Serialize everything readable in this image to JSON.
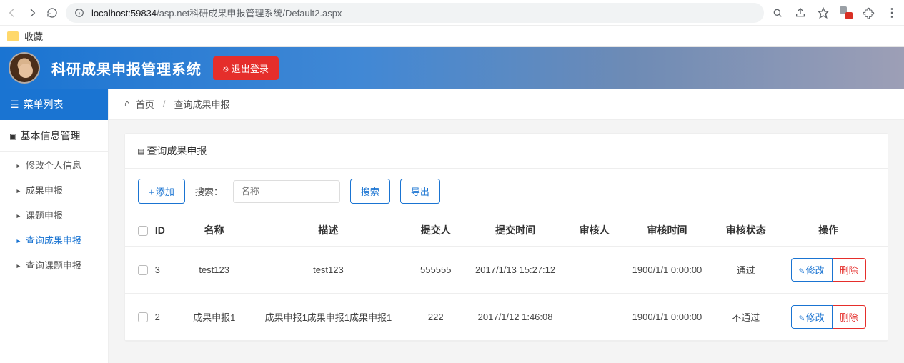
{
  "browser": {
    "url_host": "localhost:",
    "url_port": "59834",
    "url_path": "/asp.net科研成果申报管理系统/Default2.aspx",
    "bookmark_label": "收藏"
  },
  "header": {
    "brand": "科研成果申报管理系统",
    "logout_label": "退出登录"
  },
  "sidebar": {
    "menu_header": "菜单列表",
    "group_header": "基本信息管理",
    "items": [
      {
        "label": "修改个人信息",
        "active": false
      },
      {
        "label": "成果申报",
        "active": false
      },
      {
        "label": "课题申报",
        "active": false
      },
      {
        "label": "查询成果申报",
        "active": true
      },
      {
        "label": "查询课题申报",
        "active": false
      }
    ]
  },
  "breadcrumb": {
    "home": "首页",
    "current": "查询成果申报"
  },
  "panel": {
    "title": "查询成果申报",
    "add_label": "添加",
    "search_label": "搜索：",
    "search_placeholder": "名称",
    "search_button": "搜索",
    "export_button": "导出"
  },
  "table": {
    "columns": [
      "ID",
      "名称",
      "描述",
      "提交人",
      "提交时间",
      "审核人",
      "审核时间",
      "审核状态",
      "操作"
    ],
    "rows": [
      {
        "id": "3",
        "name": "test123",
        "desc": "test123",
        "submitter": "555555",
        "submit_time": "2017/1/13 15:27:12",
        "reviewer": "",
        "review_time": "1900/1/1 0:00:00",
        "status": "通过"
      },
      {
        "id": "2",
        "name": "成果申报1",
        "desc": "成果申报1成果申报1成果申报1",
        "submitter": "222",
        "submit_time": "2017/1/12 1:46:08",
        "reviewer": "",
        "review_time": "1900/1/1 0:00:00",
        "status": "不通过"
      }
    ],
    "edit_label": "修改",
    "delete_label": "删除"
  }
}
